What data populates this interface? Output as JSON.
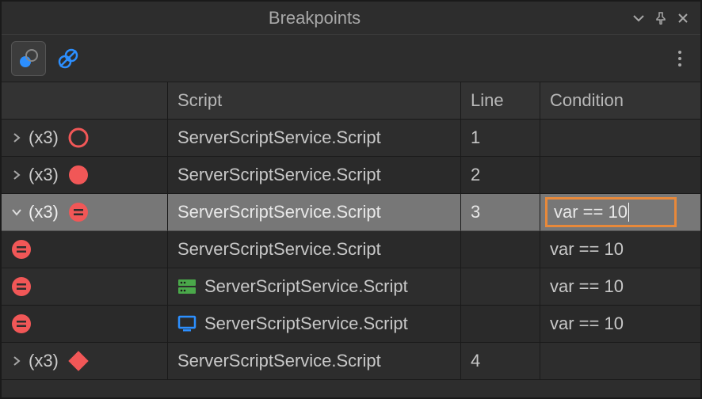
{
  "title": "Breakpoints",
  "columns": {
    "breakpoint": "",
    "script": "Script",
    "line": "Line",
    "condition": "Condition"
  },
  "colors": {
    "red": "#f15757",
    "blue": "#2c8fff",
    "green": "#4aa84a",
    "orange": "#e8893a"
  },
  "rows": [
    {
      "expander": "collapsed",
      "count": "(x3)",
      "bp_type": "circle-outline",
      "indent": 0,
      "script_icon": "none",
      "script": "ServerScriptService.Script",
      "line": "1",
      "condition": ""
    },
    {
      "expander": "collapsed",
      "count": "(x3)",
      "bp_type": "circle-filled",
      "indent": 0,
      "script_icon": "none",
      "script": "ServerScriptService.Script",
      "line": "2",
      "condition": ""
    },
    {
      "expander": "expanded",
      "count": "(x3)",
      "bp_type": "equals",
      "indent": 0,
      "script_icon": "none",
      "script": "ServerScriptService.Script",
      "line": "3",
      "condition": "var == 10",
      "selected": true,
      "editing": true
    },
    {
      "expander": "none",
      "count": "",
      "bp_type": "equals",
      "indent": 1,
      "script_icon": "none",
      "script": "ServerScriptService.Script",
      "line": "",
      "condition": "var == 10"
    },
    {
      "expander": "none",
      "count": "",
      "bp_type": "equals",
      "indent": 1,
      "script_icon": "server",
      "script": "ServerScriptService.Script",
      "line": "",
      "condition": "var == 10"
    },
    {
      "expander": "none",
      "count": "",
      "bp_type": "equals",
      "indent": 1,
      "script_icon": "client",
      "script": "ServerScriptService.Script",
      "line": "",
      "condition": "var == 10"
    },
    {
      "expander": "collapsed",
      "count": "(x3)",
      "bp_type": "diamond",
      "indent": 0,
      "script_icon": "none",
      "script": "ServerScriptService.Script",
      "line": "4",
      "condition": ""
    }
  ]
}
